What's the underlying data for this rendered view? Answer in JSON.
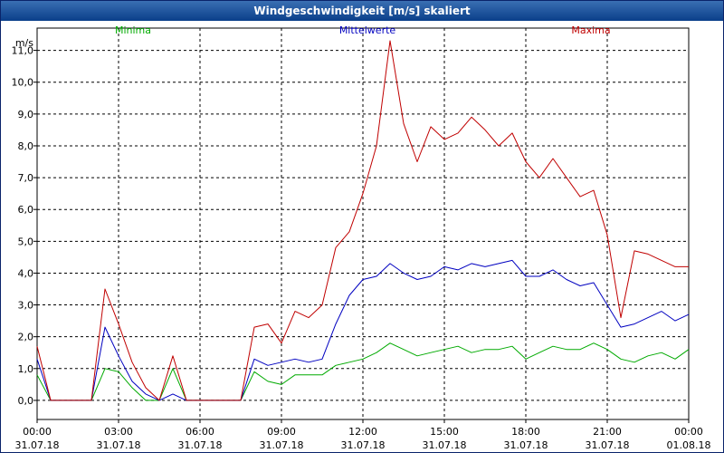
{
  "window": {
    "title": "Windgeschwindigkeit [m/s] skaliert"
  },
  "chart_data": {
    "type": "line",
    "title": "Windgeschwindigkeit [m/s] skaliert",
    "ylabel": "m/s",
    "ylim": [
      -0.6,
      11.7
    ],
    "grid": true,
    "legend_placement": "top",
    "yticks": [
      "0,0",
      "1,0",
      "2,0",
      "3,0",
      "4,0",
      "5,0",
      "6,0",
      "7,0",
      "8,0",
      "9,0",
      "10,0",
      "11,0"
    ],
    "ytick_values": [
      0,
      1,
      2,
      3,
      4,
      5,
      6,
      7,
      8,
      9,
      10,
      11
    ],
    "xlim": [
      "31.07.18 00:00",
      "01.08.18 00:00"
    ],
    "xticks": [
      {
        "time": "00:00",
        "date": "31.07.18"
      },
      {
        "time": "03:00",
        "date": "31.07.18"
      },
      {
        "time": "06:00",
        "date": "31.07.18"
      },
      {
        "time": "09:00",
        "date": "31.07.18"
      },
      {
        "time": "12:00",
        "date": "31.07.18"
      },
      {
        "time": "15:00",
        "date": "31.07.18"
      },
      {
        "time": "18:00",
        "date": "31.07.18"
      },
      {
        "time": "21:00",
        "date": "31.07.18"
      },
      {
        "time": "00:00",
        "date": "01.08.18"
      }
    ],
    "x": [
      "00:00",
      "00:30",
      "01:00",
      "01:30",
      "02:00",
      "02:30",
      "03:00",
      "03:30",
      "04:00",
      "04:30",
      "05:00",
      "05:30",
      "06:00",
      "06:30",
      "07:00",
      "07:30",
      "08:00",
      "08:30",
      "09:00",
      "09:30",
      "10:00",
      "10:30",
      "11:00",
      "11:30",
      "12:00",
      "12:30",
      "13:00",
      "13:30",
      "14:00",
      "14:30",
      "15:00",
      "15:30",
      "16:00",
      "16:30",
      "17:00",
      "17:30",
      "18:00",
      "18:30",
      "19:00",
      "19:30",
      "20:00",
      "20:30",
      "21:00",
      "21:30",
      "22:00",
      "22:30",
      "23:00",
      "23:30",
      "00:00"
    ],
    "series": [
      {
        "name": "Minima",
        "color": "#00aa00",
        "values": [
          0.8,
          0,
          0,
          0,
          0,
          1.0,
          0.9,
          0.4,
          0,
          0,
          1.0,
          0,
          0,
          0,
          0,
          0,
          0.9,
          0.6,
          0.5,
          0.8,
          0.8,
          0.8,
          1.1,
          1.2,
          1.3,
          1.5,
          1.8,
          1.6,
          1.4,
          1.5,
          1.6,
          1.7,
          1.5,
          1.6,
          1.6,
          1.7,
          1.3,
          1.5,
          1.7,
          1.6,
          1.6,
          1.8,
          1.6,
          1.3,
          1.2,
          1.4,
          1.5,
          1.3,
          1.6
        ]
      },
      {
        "name": "Mittelwerte",
        "color": "#0000c0",
        "values": [
          1.3,
          0,
          0,
          0,
          0,
          2.3,
          1.4,
          0.6,
          0.2,
          0,
          0.2,
          0,
          0,
          0,
          0,
          0,
          1.3,
          1.1,
          1.2,
          1.3,
          1.2,
          1.3,
          2.4,
          3.3,
          3.8,
          3.9,
          4.3,
          4.0,
          3.8,
          3.9,
          4.2,
          4.1,
          4.3,
          4.2,
          4.3,
          4.4,
          3.9,
          3.9,
          4.1,
          3.8,
          3.6,
          3.7,
          3.0,
          2.3,
          2.4,
          2.6,
          2.8,
          2.5,
          2.7
        ]
      },
      {
        "name": "Maxima",
        "color": "#c00000",
        "values": [
          1.7,
          0,
          0,
          0,
          0,
          3.5,
          2.4,
          1.2,
          0.4,
          0,
          1.4,
          0,
          0,
          0,
          0,
          0,
          2.3,
          2.4,
          1.8,
          2.8,
          2.6,
          3.0,
          4.8,
          5.3,
          6.5,
          8.0,
          11.3,
          8.7,
          7.5,
          8.6,
          8.2,
          8.4,
          8.9,
          8.5,
          8.0,
          8.4,
          7.5,
          7.0,
          7.6,
          7.0,
          6.4,
          6.6,
          5.2,
          2.6,
          4.7,
          4.6,
          4.4,
          4.2,
          4.2
        ]
      }
    ]
  }
}
